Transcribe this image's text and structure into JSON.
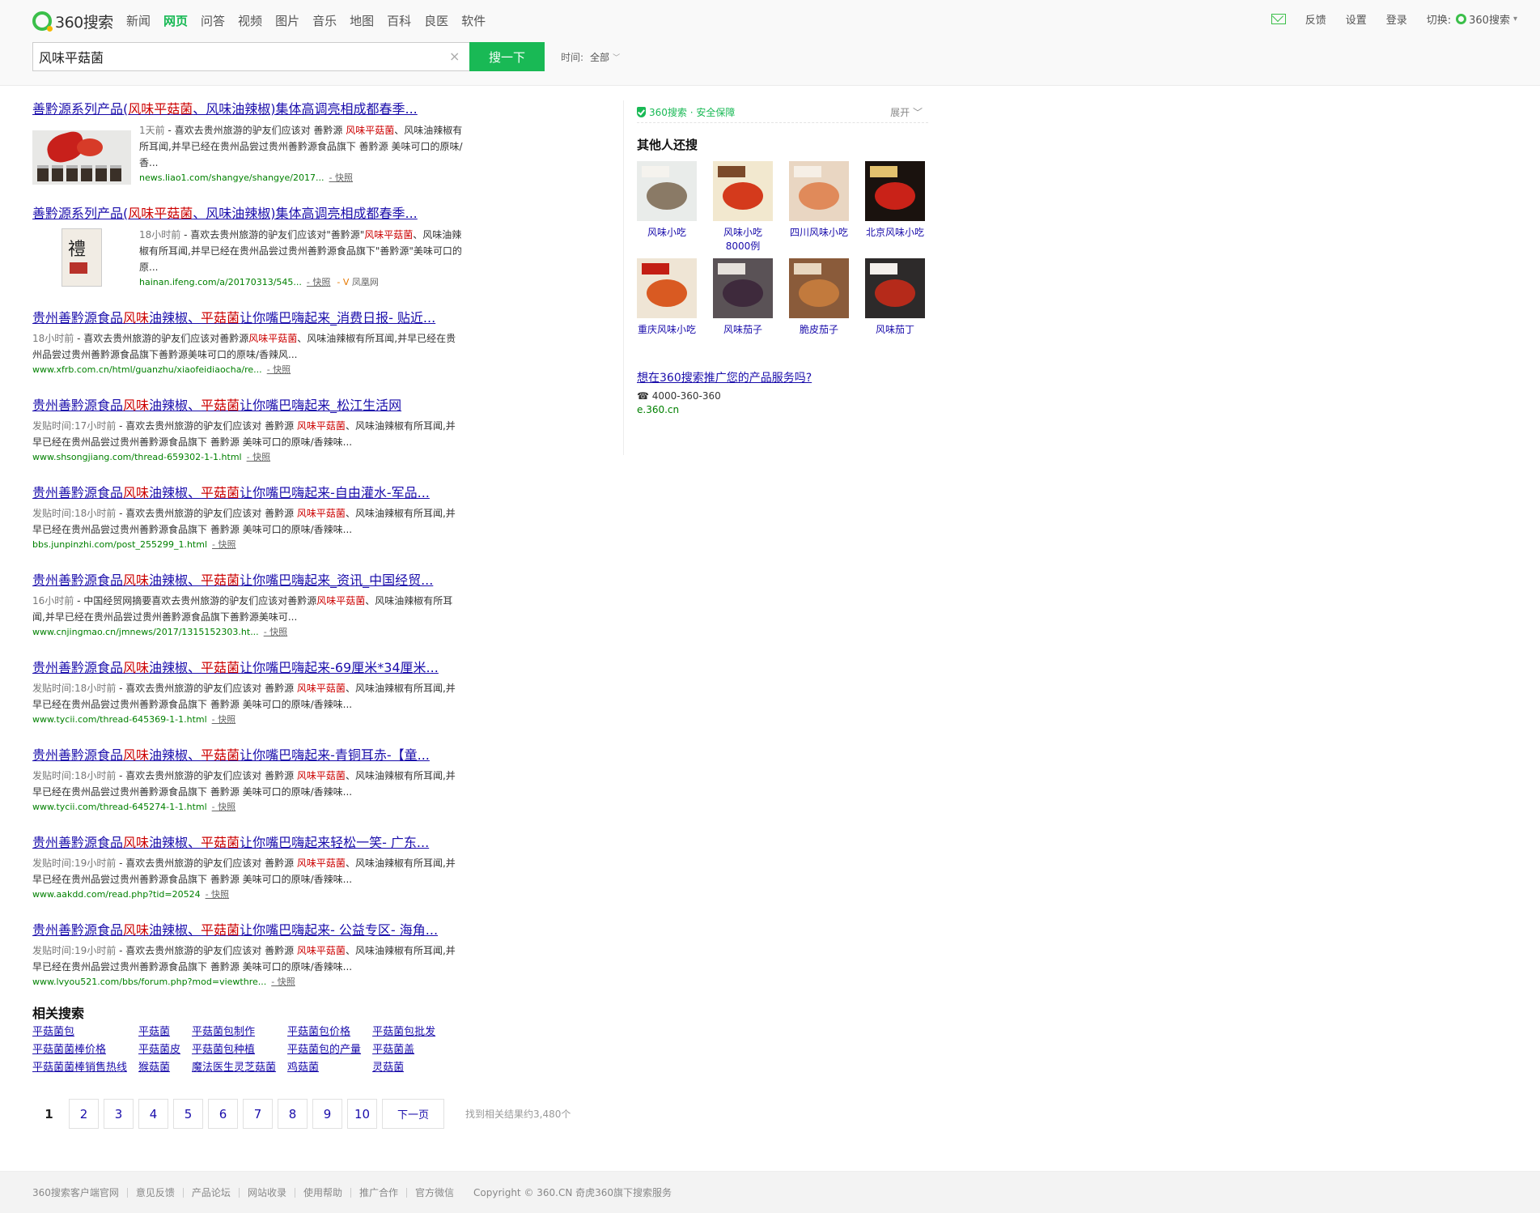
{
  "header": {
    "logo_text": "360搜索",
    "nav": [
      {
        "label": "新闻",
        "active": false
      },
      {
        "label": "网页",
        "active": true
      },
      {
        "label": "问答",
        "active": false
      },
      {
        "label": "视频",
        "active": false
      },
      {
        "label": "图片",
        "active": false
      },
      {
        "label": "音乐",
        "active": false
      },
      {
        "label": "地图",
        "active": false
      },
      {
        "label": "百科",
        "active": false
      },
      {
        "label": "良医",
        "active": false
      },
      {
        "label": "软件",
        "active": false
      }
    ],
    "toplinks": {
      "feedback": "反馈",
      "settings": "设置",
      "login": "登录",
      "switch_label": "切换:",
      "switch_value": "360搜索"
    },
    "search": {
      "value": "风味平菇菌",
      "button": "搜一下",
      "time_label": "时间:",
      "time_value": "全部"
    }
  },
  "results": [
    {
      "title_parts": [
        "善黔源系列产品(",
        "风味平菇菌",
        "、风味油辣椒)集体高调亮相成都春季..."
      ],
      "date": "1天前",
      "desc_parts": [
        " - 喜欢去贵州旅游的驴友们应该对 善黔源 ",
        "风味平菇菌",
        "、风味油辣椒有所耳闻,并早已经在贵州品尝过贵州善黔源食品旗下 善黔源 美味可口的原味/香..."
      ],
      "url": "news.liao1.com/shangye/shangye/2017...",
      "snapshot": "快照",
      "thumb": "product-thumb"
    },
    {
      "title_parts": [
        "善黔源系列产品(",
        "风味平菇菌",
        "、风味油辣椒)集体高调亮相成都春季..."
      ],
      "date": "18小时前",
      "desc_parts": [
        " - 喜欢去贵州旅游的驴友们应该对\"善黔源\"",
        "风味平菇菌",
        "、风味油辣椒有所耳闻,并早已经在贵州品尝过贵州善黔源食品旗下\"善黔源\"美味可口的原..."
      ],
      "url": "hainan.ifeng.com/a/20170313/545...",
      "snapshot": "快照",
      "source": "凤凰网",
      "thumb": "book-thumb"
    },
    {
      "title_parts": [
        "贵州善黔源食品",
        "风味",
        "油辣椒、",
        "平菇菌",
        "让你嘴巴嗨起来_消费日报- 贴近..."
      ],
      "date": "18小时前",
      "desc_parts": [
        " - 喜欢去贵州旅游的驴友们应该对善黔源",
        "风味平菇菌",
        "、风味油辣椒有所耳闻,并早已经在贵州品尝过贵州善黔源食品旗下善黔源美味可口的原味/香辣风..."
      ],
      "url": "www.xfrb.com.cn/html/guanzhu/xiaofeidiaocha/re...",
      "snapshot": "快照"
    },
    {
      "title_parts": [
        "贵州善黔源食品",
        "风味",
        "油辣椒、",
        "平菇菌",
        "让你嘴巴嗨起来_松江生活网"
      ],
      "date": "发贴时间:17小时前",
      "desc_parts": [
        " - 喜欢去贵州旅游的驴友们应该对 善黔源 ",
        "风味平菇菌",
        "、风味油辣椒有所耳闻,并早已经在贵州品尝过贵州善黔源食品旗下 善黔源 美味可口的原味/香辣味..."
      ],
      "url": "www.shsongjiang.com/thread-659302-1-1.html",
      "snapshot": "快照"
    },
    {
      "title_parts": [
        "贵州善黔源食品",
        "风味",
        "油辣椒、",
        "平菇菌",
        "让你嘴巴嗨起来-自由灌水-军品..."
      ],
      "date": "发贴时间:18小时前",
      "desc_parts": [
        " - 喜欢去贵州旅游的驴友们应该对 善黔源 ",
        "风味平菇菌",
        "、风味油辣椒有所耳闻,并早已经在贵州品尝过贵州善黔源食品旗下 善黔源 美味可口的原味/香辣味..."
      ],
      "url": "bbs.junpinzhi.com/post_255299_1.html",
      "snapshot": "快照"
    },
    {
      "title_parts": [
        "贵州善黔源食品",
        "风味",
        "油辣椒、",
        "平菇菌",
        "让你嘴巴嗨起来_资讯_中国经贸..."
      ],
      "date": "16小时前",
      "desc_parts": [
        " - 中国经贸网摘要喜欢去贵州旅游的驴友们应该对善黔源",
        "风味平菇菌",
        "、风味油辣椒有所耳闻,并早已经在贵州品尝过贵州善黔源食品旗下善黔源美味可..."
      ],
      "url": "www.cnjingmao.cn/jmnews/2017/1315152303.ht...",
      "snapshot": "快照"
    },
    {
      "title_parts": [
        "贵州善黔源食品",
        "风味",
        "油辣椒、",
        "平菇菌",
        "让你嘴巴嗨起来-69厘米*34厘米..."
      ],
      "date": "发贴时间:18小时前",
      "desc_parts": [
        " - 喜欢去贵州旅游的驴友们应该对 善黔源 ",
        "风味平菇菌",
        "、风味油辣椒有所耳闻,并早已经在贵州品尝过贵州善黔源食品旗下 善黔源 美味可口的原味/香辣味..."
      ],
      "url": "www.tycii.com/thread-645369-1-1.html",
      "snapshot": "快照"
    },
    {
      "title_parts": [
        "贵州善黔源食品",
        "风味",
        "油辣椒、",
        "平菇菌",
        "让你嘴巴嗨起来-青铜耳赤-【童..."
      ],
      "date": "发贴时间:18小时前",
      "desc_parts": [
        " - 喜欢去贵州旅游的驴友们应该对 善黔源 ",
        "风味平菇菌",
        "、风味油辣椒有所耳闻,并早已经在贵州品尝过贵州善黔源食品旗下 善黔源 美味可口的原味/香辣味..."
      ],
      "url": "www.tycii.com/thread-645274-1-1.html",
      "snapshot": "快照"
    },
    {
      "title_parts": [
        "贵州善黔源食品",
        "风味",
        "油辣椒、",
        "平菇菌",
        "让你嘴巴嗨起来轻松一笑- 广东..."
      ],
      "date": "发贴时间:19小时前",
      "desc_parts": [
        " - 喜欢去贵州旅游的驴友们应该对 善黔源 ",
        "风味平菇菌",
        "、风味油辣椒有所耳闻,并早已经在贵州品尝过贵州善黔源食品旗下 善黔源 美味可口的原味/香辣味..."
      ],
      "url": "www.aakdd.com/read.php?tid=20524",
      "snapshot": "快照"
    },
    {
      "title_parts": [
        "贵州善黔源食品",
        "风味",
        "油辣椒、",
        "平菇菌",
        "让你嘴巴嗨起来- 公益专区- 海角..."
      ],
      "date": "发贴时间:19小时前",
      "desc_parts": [
        " - 喜欢去贵州旅游的驴友们应该对 善黔源 ",
        "风味平菇菌",
        "、风味油辣椒有所耳闻,并早已经在贵州品尝过贵州善黔源食品旗下 善黔源 美味可口的原味/香辣味..."
      ],
      "url": "www.lvyou521.com/bbs/forum.php?mod=viewthre...",
      "snapshot": "快照"
    }
  ],
  "related": {
    "title": "相关搜索",
    "rows": [
      [
        "平菇菌包",
        "平菇菌",
        "平菇菌包制作",
        "平菇菌包价格",
        "平菇菌包批发"
      ],
      [
        "平菇菌菌棒价格",
        "平菇菌皮",
        "平菇菌包种植",
        "平菇菌包的产量",
        "平菇菌盖"
      ],
      [
        "平菇菌菌棒销售热线",
        "猴菇菌",
        "魔法医生灵芝菇菌",
        "鸡菇菌",
        "灵菇菌"
      ]
    ]
  },
  "pager": {
    "pages": [
      "1",
      "2",
      "3",
      "4",
      "5",
      "6",
      "7",
      "8",
      "9",
      "10"
    ],
    "current": "1",
    "next": "下一页",
    "count": "找到相关结果约3,480个"
  },
  "sidebar": {
    "safe_label": "360搜索 · 安全保障",
    "expand": "展开",
    "others_title": "其他人还搜",
    "others": [
      {
        "label": "风味小吃",
        "img": "snack-book-cover"
      },
      {
        "label": "风味小吃8000例",
        "img": "snack-8000-cover"
      },
      {
        "label": "四川风味小吃",
        "img": "sichuan-dish"
      },
      {
        "label": "北京风味小吃",
        "img": "beijing-cover"
      },
      {
        "label": "重庆风味小吃",
        "img": "chongqing-cover"
      },
      {
        "label": "风味茄子",
        "img": "eggplant-dish"
      },
      {
        "label": "脆皮茄子",
        "img": "crispy-eggplant"
      },
      {
        "label": "风味茄丁",
        "img": "diced-eggplant"
      }
    ],
    "promo_link": "想在360搜索推广您的产品服务吗?",
    "promo_phone": "☎ 4000-360-360",
    "promo_site": "e.360.cn"
  },
  "footer": {
    "links": [
      "360搜索客户端官网",
      "意见反馈",
      "产品论坛",
      "网站收录",
      "使用帮助",
      "推广合作",
      "官方微信"
    ],
    "copyright": "Copyright © 360.CN 奇虎360旗下搜索服务"
  },
  "colors": {
    "brand_green": "#19b955",
    "link_blue": "#1a0dab",
    "highlight_red": "#cc0000",
    "url_green": "#008000"
  }
}
